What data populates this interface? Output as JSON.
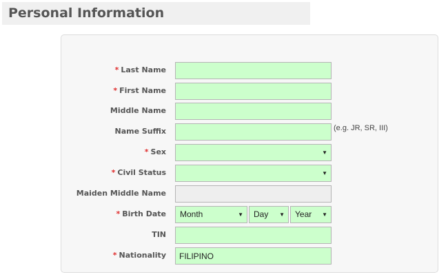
{
  "section": {
    "title": "Personal Information"
  },
  "fields": {
    "last_name": {
      "label": "Last Name",
      "required": "*",
      "value": ""
    },
    "first_name": {
      "label": "First Name",
      "required": "*",
      "value": ""
    },
    "middle_name": {
      "label": "Middle Name",
      "value": ""
    },
    "name_suffix": {
      "label": "Name Suffix",
      "value": "",
      "hint": "(e.g. JR, SR, III)"
    },
    "sex": {
      "label": "Sex",
      "required": "*",
      "selected": ""
    },
    "civil_status": {
      "label": "Civil Status",
      "required": "*",
      "selected": ""
    },
    "maiden_middle_name": {
      "label": "Maiden Middle Name",
      "value": ""
    },
    "birth_date": {
      "label": "Birth Date",
      "required": "*",
      "month": "Month",
      "day": "Day",
      "year": "Year"
    },
    "tin": {
      "label": "TIN",
      "value": ""
    },
    "nationality": {
      "label": "Nationality",
      "required": "*",
      "value": "FILIPINO"
    }
  },
  "icons": {
    "dropdown": "▼"
  },
  "colors": {
    "field_bg": "#ccffcc",
    "disabled_bg": "#eeeeee",
    "required": "#e03030",
    "label": "#555555"
  }
}
